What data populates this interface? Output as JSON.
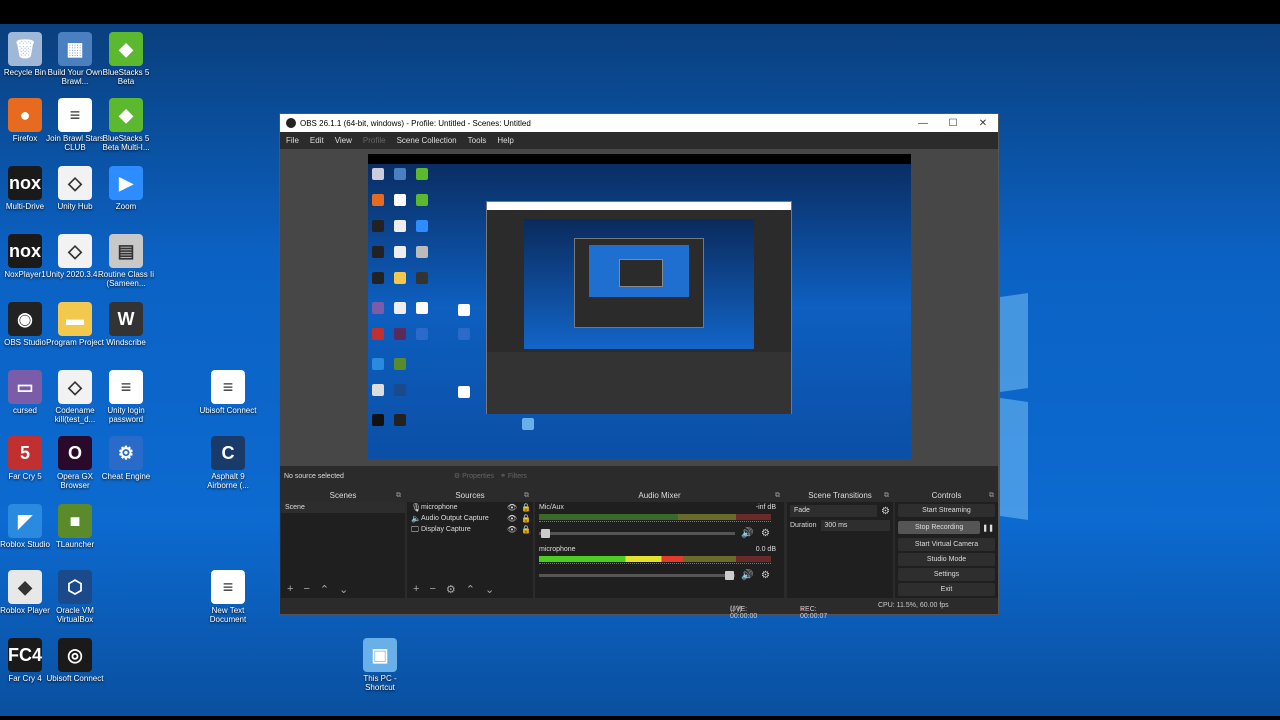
{
  "desktop": {
    "icons": [
      {
        "label": "Recycle Bin",
        "icon": "recycle-bin-icon",
        "color": "#9fb8d8",
        "glyph": "🗑"
      },
      {
        "label": "Build Your Own Brawl...",
        "icon": "document-icon",
        "color": "#4a7fc0",
        "glyph": "▦"
      },
      {
        "label": "BlueStacks 5 Beta",
        "icon": "bluestacks-icon",
        "color": "#5cb82e",
        "glyph": "◆"
      },
      {
        "label": "Firefox",
        "icon": "firefox-icon",
        "color": "#e66a1f",
        "glyph": "●"
      },
      {
        "label": "Join Brawl Stars CLUB",
        "icon": "text-file-icon",
        "color": "#ffffff",
        "glyph": "≡"
      },
      {
        "label": "BlueStacks 5 Beta Multi-I...",
        "icon": "bluestacks-multi-icon",
        "color": "#5cb82e",
        "glyph": "◆"
      },
      {
        "label": "Multi-Drive",
        "icon": "nox-icon",
        "color": "#1a1a1a",
        "glyph": "nox"
      },
      {
        "label": "Unity Hub",
        "icon": "unity-icon",
        "color": "#f2f2f2",
        "glyph": "◇"
      },
      {
        "label": "Zoom",
        "icon": "zoom-icon",
        "color": "#2d8cff",
        "glyph": "▶"
      },
      {
        "label": "NoxPlayer1",
        "icon": "nox-icon",
        "color": "#1a1a1a",
        "glyph": "nox"
      },
      {
        "label": "Unity 2020.3.4...",
        "icon": "unity-icon",
        "color": "#f2f2f2",
        "glyph": "◇"
      },
      {
        "label": "Routine Class Ii (Sameen...",
        "icon": "spreadsheet-icon",
        "color": "#c8c8c8",
        "glyph": "▤"
      },
      {
        "label": "OBS Studio",
        "icon": "obs-icon",
        "color": "#222222",
        "glyph": "◉"
      },
      {
        "label": "Program Project",
        "icon": "folder-icon",
        "color": "#f2c94c",
        "glyph": "▬"
      },
      {
        "label": "Windscribe",
        "icon": "windscribe-icon",
        "color": "#333333",
        "glyph": "W"
      },
      {
        "label": "cursed",
        "icon": "image-icon",
        "color": "#7a5ca8",
        "glyph": "▭"
      },
      {
        "label": "Codename kill(test_d...",
        "icon": "unity-icon",
        "color": "#f2f2f2",
        "glyph": "◇"
      },
      {
        "label": "Unity login password",
        "icon": "text-file-icon",
        "color": "#ffffff",
        "glyph": "≡"
      },
      {
        "label": "Ubisoft Connect",
        "icon": "text-file-icon",
        "color": "#ffffff",
        "glyph": "≡"
      },
      {
        "label": "Far Cry 5",
        "icon": "farcry5-icon",
        "color": "#c03030",
        "glyph": "5"
      },
      {
        "label": "Opera GX Browser",
        "icon": "opera-gx-icon",
        "color": "#2a0a2a",
        "glyph": "O"
      },
      {
        "label": "Cheat Engine",
        "icon": "cheat-engine-icon",
        "color": "#2a6ac8",
        "glyph": "⚙"
      },
      {
        "label": "Asphalt 9 Airborne (...",
        "icon": "asphalt-icon",
        "color": "#1a3a6a",
        "glyph": "C"
      },
      {
        "label": "Roblox Studio",
        "icon": "roblox-studio-icon",
        "color": "#2a8ae0",
        "glyph": "◤"
      },
      {
        "label": "TLauncher",
        "icon": "minecraft-icon",
        "color": "#5a8a2a",
        "glyph": "■"
      },
      {
        "label": "Roblox Player",
        "icon": "roblox-icon",
        "color": "#e8e8e8",
        "glyph": "◆"
      },
      {
        "label": "Oracle VM VirtualBox",
        "icon": "virtualbox-icon",
        "color": "#1a4a8a",
        "glyph": "⬡"
      },
      {
        "label": "New Text Document",
        "icon": "text-file-icon",
        "color": "#ffffff",
        "glyph": "≡"
      },
      {
        "label": "Far Cry 4",
        "icon": "farcry4-icon",
        "color": "#1a1a1a",
        "glyph": "FC4"
      },
      {
        "label": "Ubisoft Connect",
        "icon": "ubisoft-icon",
        "color": "#1a1a1a",
        "glyph": "◎"
      },
      {
        "label": "This PC - Shortcut",
        "icon": "this-pc-icon",
        "color": "#6ab0e8",
        "glyph": "▣"
      }
    ]
  },
  "window": {
    "title": "OBS 26.1.1 (64-bit, windows) - Profile: Untitled - Scenes: Untitled",
    "minimize": "—",
    "maximize": "☐",
    "close": "✕"
  },
  "menu": {
    "items": [
      "File",
      "Edit",
      "View",
      "Profile",
      "Scene Collection",
      "Tools",
      "Help"
    ]
  },
  "status": {
    "no_source": "No source selected",
    "properties": "Properties",
    "filters": "Filters"
  },
  "scenes": {
    "title": "Scenes",
    "items": [
      "Scene"
    ]
  },
  "sources": {
    "title": "Sources",
    "items": [
      {
        "name": "microphone",
        "icon": "🎙"
      },
      {
        "name": "Audio Output Capture",
        "icon": "🔈"
      },
      {
        "name": "Display Capture",
        "icon": "🖵"
      }
    ]
  },
  "mixer": {
    "title": "Audio Mixer",
    "channels": [
      {
        "name": "Mic/Aux",
        "db": "-inf dB",
        "level": 0.0,
        "volume": 0.03
      },
      {
        "name": "microphone",
        "db": "0.0 dB",
        "level": 0.62,
        "volume": 0.97
      }
    ]
  },
  "transitions": {
    "title": "Scene Transitions",
    "selected": "Fade",
    "duration_label": "Duration",
    "duration_value": "300 ms"
  },
  "controls": {
    "title": "Controls",
    "buttons": [
      "Start Streaming",
      "Stop Recording",
      "Start Virtual Camera",
      "Studio Mode",
      "Settings",
      "Exit"
    ],
    "pause": "❚❚"
  },
  "bottom": {
    "live": "LIVE: 00:00:00",
    "rec": "REC: 00:00:07",
    "cpu": "CPU: 11.5%, 60.00 fps"
  }
}
